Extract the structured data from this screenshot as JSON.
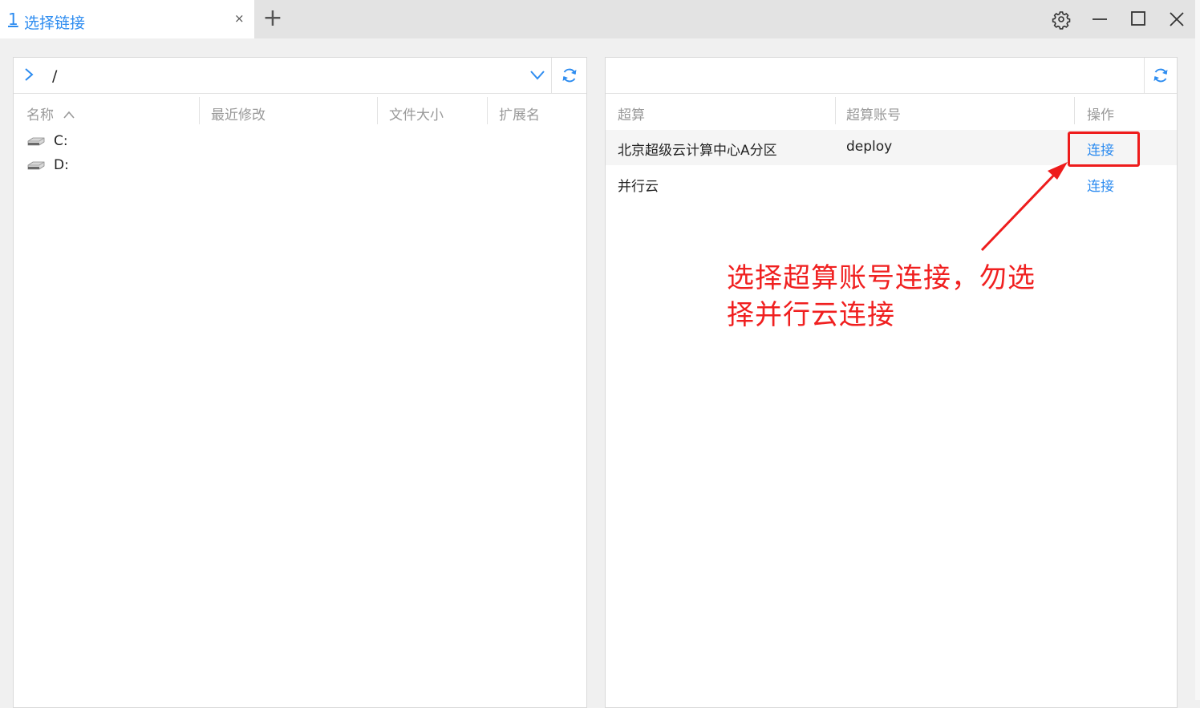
{
  "tabs": [
    {
      "number": "1",
      "label": "选择链接",
      "close": "×"
    }
  ],
  "add_tab": "+",
  "accent_color": "#2d8cf0",
  "annotation_color": "#ee1c1c",
  "window_controls": [
    "gear-icon",
    "minimize-icon",
    "maximize-icon",
    "close-icon"
  ],
  "left_panel": {
    "path": "/",
    "columns": [
      {
        "label": "名称",
        "sort": "^"
      },
      {
        "label": "最近修改"
      },
      {
        "label": "文件大小"
      },
      {
        "label": "扩展名"
      }
    ],
    "files": [
      {
        "name": "C:",
        "icon": "drive-icon"
      },
      {
        "name": "D:",
        "icon": "drive-icon"
      }
    ]
  },
  "right_panel": {
    "search_value": "",
    "columns": [
      "超算",
      "超算账号",
      "操作"
    ],
    "rows": [
      {
        "name": "北京超级云计算中心A分区",
        "account": "deploy",
        "action": "连接",
        "highlighted": true
      },
      {
        "name": "并行云",
        "account": "",
        "action": "连接",
        "highlighted": false
      }
    ]
  },
  "annotation": {
    "line1": "选择超算账号连接，勿选",
    "line2": "择并行云连接"
  }
}
